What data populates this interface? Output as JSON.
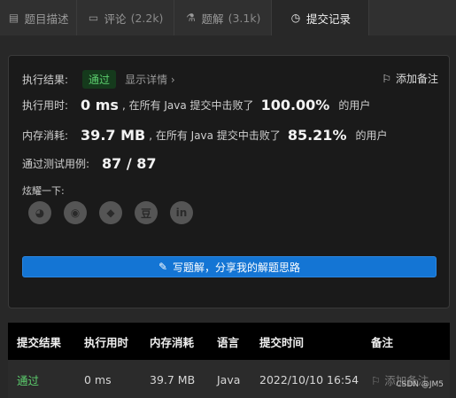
{
  "tabs": [
    {
      "icon": "document-icon",
      "label": "题目描述",
      "count": ""
    },
    {
      "icon": "comment-icon",
      "label": "评论",
      "count": "(2.2k)"
    },
    {
      "icon": "flask-icon",
      "label": "题解",
      "count": "(3.1k)"
    },
    {
      "icon": "clock-icon",
      "label": "提交记录",
      "count": ""
    }
  ],
  "result": {
    "label": "执行结果:",
    "status": "通过",
    "show_detail": "显示详情 ›",
    "add_note": "添加备注"
  },
  "runtime": {
    "label": "执行用时:",
    "value": "0 ms",
    "mid": ", 在所有 Java 提交中击败了",
    "percent": "100.00%",
    "suffix": "的用户"
  },
  "memory": {
    "label": "内存消耗:",
    "value": "39.7 MB",
    "mid": ", 在所有 Java 提交中击败了",
    "percent": "85.21%",
    "suffix": "的用户"
  },
  "testcases": {
    "label": "通过测试用例:",
    "value": "87 / 87"
  },
  "share": {
    "label": "炫耀一下:",
    "icons": [
      "wechat-icon",
      "weibo-icon",
      "qq-icon",
      "douban-icon",
      "linkedin-icon"
    ],
    "glyphs": [
      "◕",
      "◉",
      "◆",
      "豆",
      "in"
    ]
  },
  "write_button": "写题解，分享我的解题思路",
  "table": {
    "headers": [
      "提交结果",
      "执行用时",
      "内存消耗",
      "语言",
      "提交时间",
      "备注"
    ],
    "rows": [
      {
        "result": "通过",
        "runtime": "0 ms",
        "memory": "39.7 MB",
        "language": "Java",
        "time": "2022/10/10 16:54",
        "note": "添加备注"
      }
    ]
  },
  "watermark": "CSDN @JM5",
  "colors": {
    "accent": "#1475d4",
    "success": "#5ccf6e",
    "background": "#282828"
  }
}
